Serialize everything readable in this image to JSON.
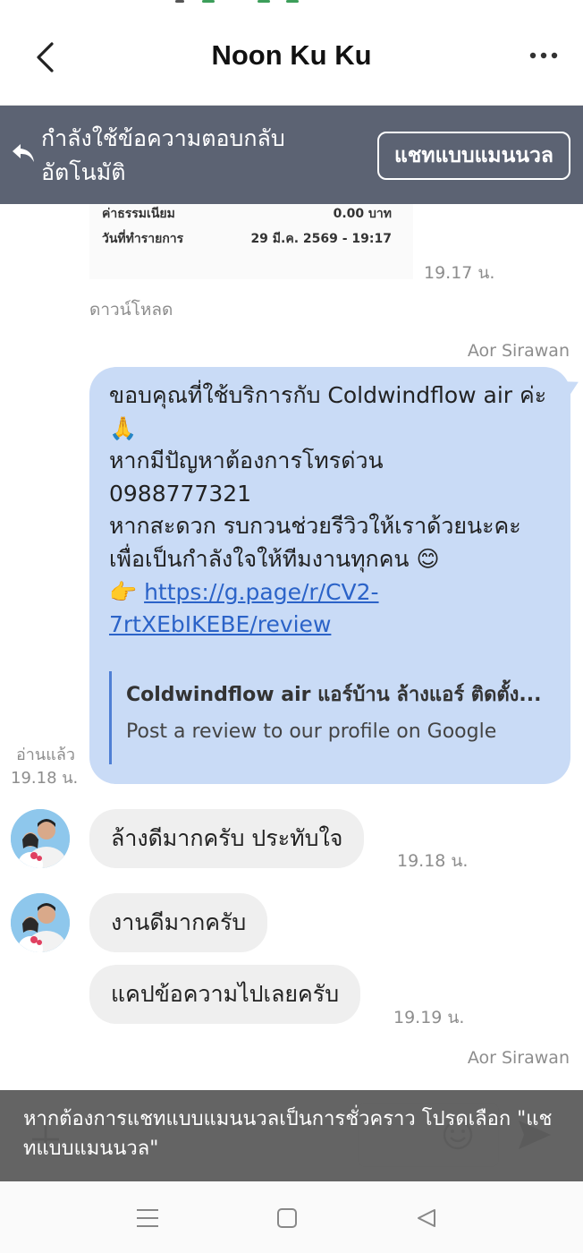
{
  "header": {
    "title": "Noon Ku Ku"
  },
  "banner": {
    "text": "กำลังใช้ข้อความตอบกลับอัตโนมัติ",
    "manual_button": "แชทแบบแมนนวล"
  },
  "messages": {
    "image_slip": {
      "row1_label": "ค่าธรรมเนียม",
      "row1_value": "0.00 บาท",
      "row2_label": "วันที่ทำรายการ",
      "row2_value": "29 มี.ค. 2569 - 19:17",
      "time": "19.17 น.",
      "download": "ดาวน์โหลด"
    },
    "outgoing": {
      "sender": "Aor Sirawan",
      "text": "ขอบคุณที่ใช้บริการกับ Coldwindflow air ค่ะ 🙏\nหากมีปัญหาต้องการโทรด่วน\n 0988777321\nหากสะดวก รบกวนช่วยรีวิวให้เราด้วยนะคะ เพื่อเป็นกำลังใจให้ทีมงานทุกคน 😊\n👉 ",
      "link": "https://g.page/r/CV2-7rtXEbIKEBE/review",
      "preview_title": "Coldwindflow air แอร์บ้าน ล้างแอร์ ติดตั้ง...",
      "preview_desc": "Post a review to our profile on Google",
      "read_label": "อ่านแล้ว",
      "time": "19.18 น."
    },
    "incoming": [
      {
        "text": "ล้างดีมากครับ ประทับใจ",
        "time": "19.18 น."
      },
      {
        "text": "งานดีมากครับ",
        "time": ""
      },
      {
        "text": "แคปข้อความไปเลยครับ",
        "time": "19.19 น."
      }
    ],
    "next_sender": "Aor Sirawan"
  },
  "toast": {
    "text": "หากต้องการแชทแบบแมนนวลเป็นการชั่วคราว โปรดเลือก \"แชทแบบแมนนวล\""
  },
  "colors": {
    "banner_bg": "#5c6373",
    "outgoing_bubble": "#c9dbf6",
    "incoming_bubble": "#efefef",
    "link": "#2b63c8"
  }
}
